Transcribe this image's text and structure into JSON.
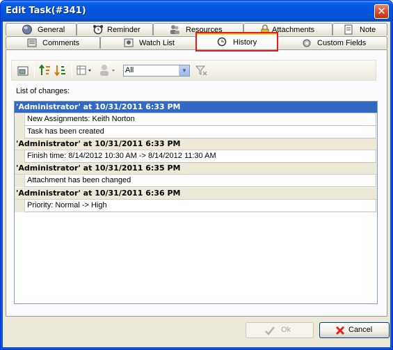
{
  "window": {
    "title": "Edit Task(#341)",
    "close_glyph": "✕"
  },
  "tabs_row1": [
    {
      "label": "General",
      "icon": "globe-icon"
    },
    {
      "label": "Reminder",
      "icon": "alarm-clock-icon"
    },
    {
      "label": "Resources",
      "icon": "people-icon"
    },
    {
      "label": "Attachments",
      "icon": "lock-attachment-icon"
    },
    {
      "label": "Note",
      "icon": "note-icon"
    }
  ],
  "tabs_row2": [
    {
      "label": "Comments",
      "icon": "comments-icon"
    },
    {
      "label": "Watch List",
      "icon": "watch-list-icon"
    },
    {
      "label": "History",
      "icon": "history-icon",
      "active": true
    },
    {
      "label": "Custom Fields",
      "icon": "custom-fields-icon"
    }
  ],
  "toolbar": {
    "filter_value": "All",
    "combo_arrow": "▼"
  },
  "list_caption": "List of changes:",
  "history": [
    {
      "header": "'Administrator' at 10/31/2011 6:33 PM",
      "selected": true,
      "items": [
        "New Assignments: Keith Norton",
        "Task has been created"
      ]
    },
    {
      "header": "'Administrator' at 10/31/2011 6:33 PM",
      "items": [
        "Finish time: 8/14/2012 10:30 AM -> 8/14/2012 11:30 AM"
      ]
    },
    {
      "header": "'Administrator' at 10/31/2011 6:35 PM",
      "items": [
        "Attachment has been changed"
      ]
    },
    {
      "header": "'Administrator' at 10/31/2011 6:36 PM",
      "items": [
        "Priority: Normal -> High"
      ]
    }
  ],
  "buttons": {
    "ok": "Ok",
    "cancel": "Cancel"
  },
  "colors": {
    "title_bar": "#0453dc",
    "selected_row": "#316ac5",
    "highlight_box": "#e21a1a",
    "active_tab_accent": "#ffc83c"
  }
}
